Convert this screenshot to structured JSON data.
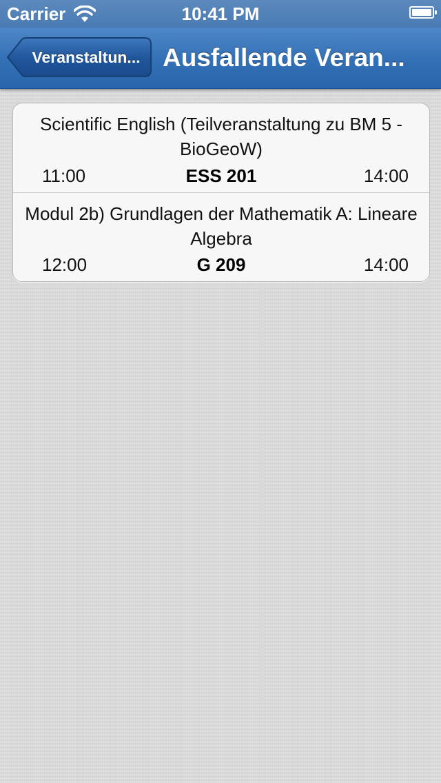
{
  "status_bar": {
    "carrier": "Carrier",
    "time": "10:41 PM",
    "icons": [
      "wifi-icon",
      "battery-icon"
    ]
  },
  "nav_bar": {
    "back_label": "Veranstaltun...",
    "title": "Ausfallende Veran..."
  },
  "events": [
    {
      "title": "Scientific English (Teilveranstaltung zu BM 5 - BioGeoW)",
      "start": "11:00",
      "room": "ESS 201",
      "end": "14:00"
    },
    {
      "title": "Modul 2b) Grundlagen der Mathematik A: Lineare Algebra",
      "start": "12:00",
      "room": "G 209",
      "end": "14:00"
    }
  ],
  "colors": {
    "nav_bar": "#3471b6",
    "background": "#dcdcdc",
    "cell_background": "#f7f7f7"
  }
}
